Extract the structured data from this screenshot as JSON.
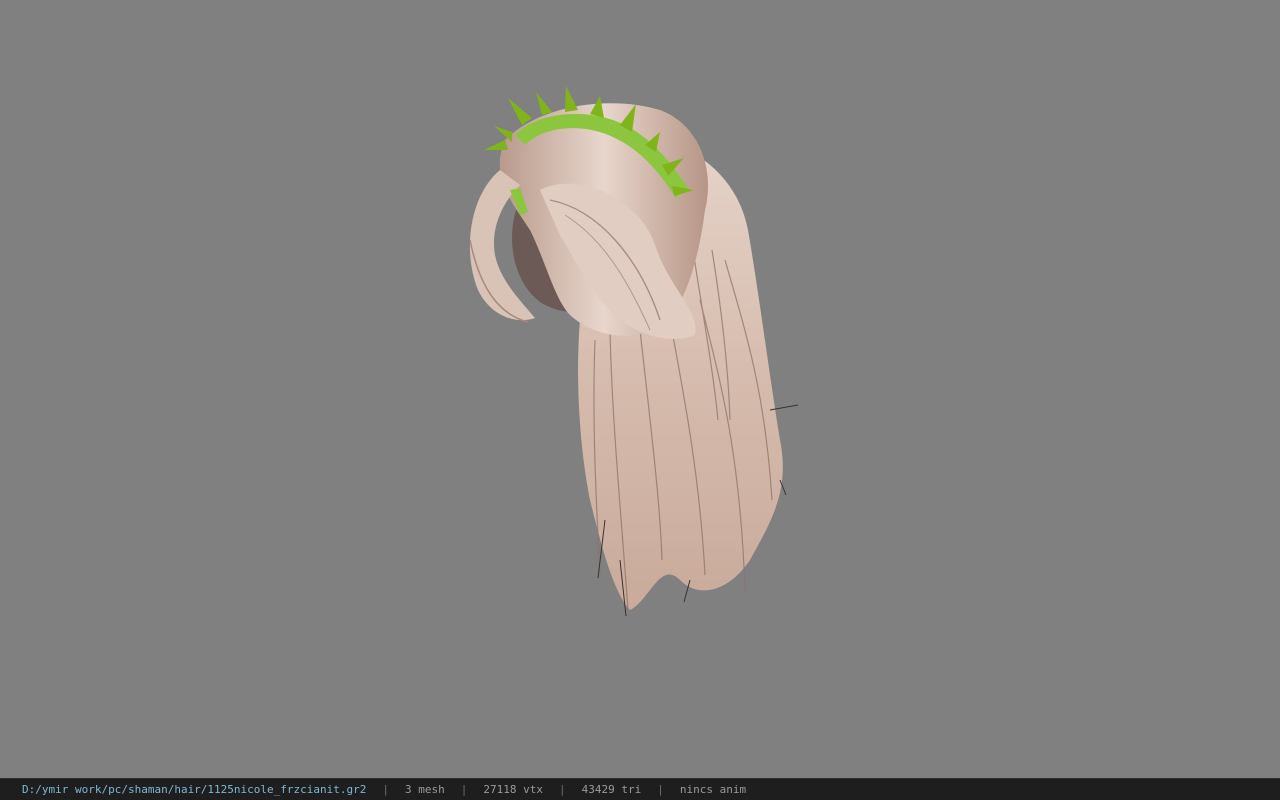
{
  "viewport": {
    "background_color": "#808080",
    "model": {
      "hair_color": "#d9c2b6",
      "headband_color": "#8cc63f",
      "spike_color": "#7fb51a"
    }
  },
  "status_bar": {
    "file_path": "D:/ymir work/pc/shaman/hair/1125nicole_frzcianit.gr2",
    "separator": "|",
    "mesh_count": "3 mesh",
    "vertex_count": "27118 vtx",
    "triangle_count": "43429 tri",
    "animation_status": "nincs anim"
  }
}
